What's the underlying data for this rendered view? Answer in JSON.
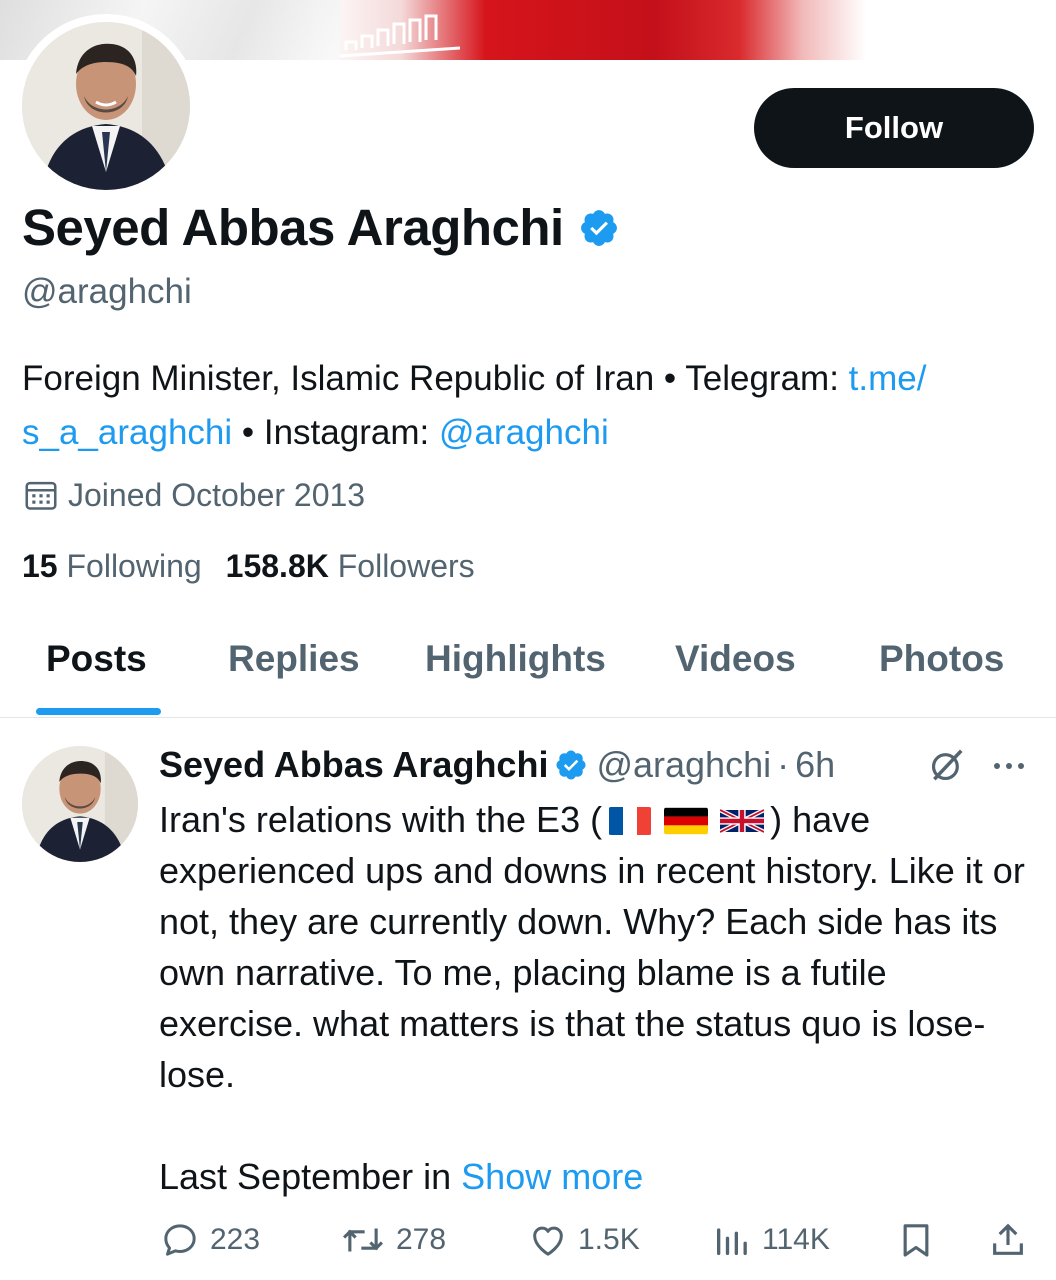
{
  "profile": {
    "name": "Seyed Abbas Araghchi",
    "handle": "@araghchi",
    "follow_label": "Follow",
    "bio": {
      "text1": "Foreign Minister, Islamic Republic of Iran • Telegram: ",
      "link1": "t.me/s_a_araghchi",
      "link1_part1": "t.me/",
      "link1_part2": "s_a_araghchi",
      "text2": " • Instagram: ",
      "link2": "@araghchi"
    },
    "joined": "Joined October 2013",
    "following_count": "15",
    "following_label": "Following",
    "followers_count": "158.8K",
    "followers_label": "Followers"
  },
  "tabs": [
    {
      "label": "Posts",
      "active": true
    },
    {
      "label": "Replies",
      "active": false
    },
    {
      "label": "Highlights",
      "active": false
    },
    {
      "label": "Videos",
      "active": false
    },
    {
      "label": "Photos",
      "active": false
    }
  ],
  "post": {
    "author_name": "Seyed Abbas Araghchi",
    "author_handle": "@araghchi",
    "separator": "·",
    "time": "6h",
    "text_part1": "Iran's relations with the E3 (",
    "text_part2": ") have experienced ups and downs in recent history. Like it or not, they are currently down. Why? Each side has its own narrative. To me, placing blame is a futile exercise. what matters is that the status quo is lose-lose.",
    "text_last": "Last September in ",
    "show_more": "Show more",
    "replies": "223",
    "reposts": "278",
    "likes": "1.5K",
    "views": "114K"
  },
  "colors": {
    "accent": "#1d9bf0",
    "text": "#0f1419",
    "muted": "#536471"
  },
  "icons": [
    "calendar-icon",
    "verified-badge-icon",
    "grok-icon",
    "more-icon",
    "reply-icon",
    "repost-icon",
    "like-icon",
    "views-icon",
    "bookmark-icon",
    "share-icon"
  ]
}
